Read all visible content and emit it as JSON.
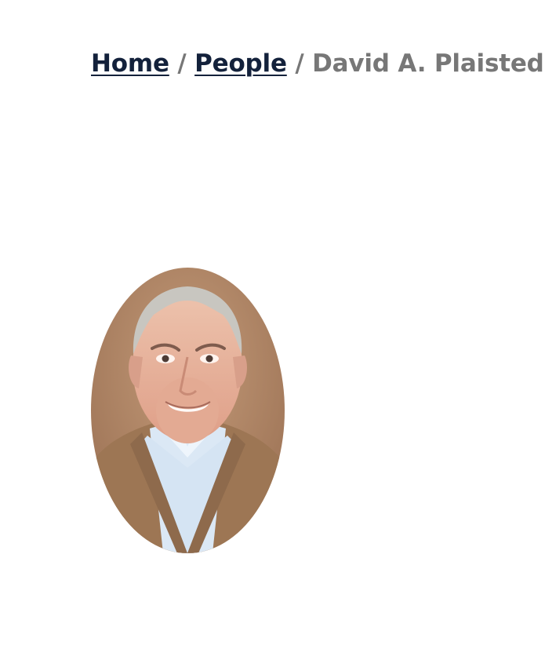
{
  "breadcrumb": {
    "home_label": "Home",
    "separator": "/",
    "people_label": "People",
    "current_label": "David A. Plaisted"
  },
  "profile": {
    "photo_icon": "person-portrait-icon"
  },
  "colors": {
    "link": "#13213b",
    "muted": "#777777",
    "photo_background": "#a87e5f",
    "sweater": "#9a7552",
    "shirt": "#d7e6f5",
    "skin": "#e8b8a2",
    "hair": "#c9c7c1"
  }
}
